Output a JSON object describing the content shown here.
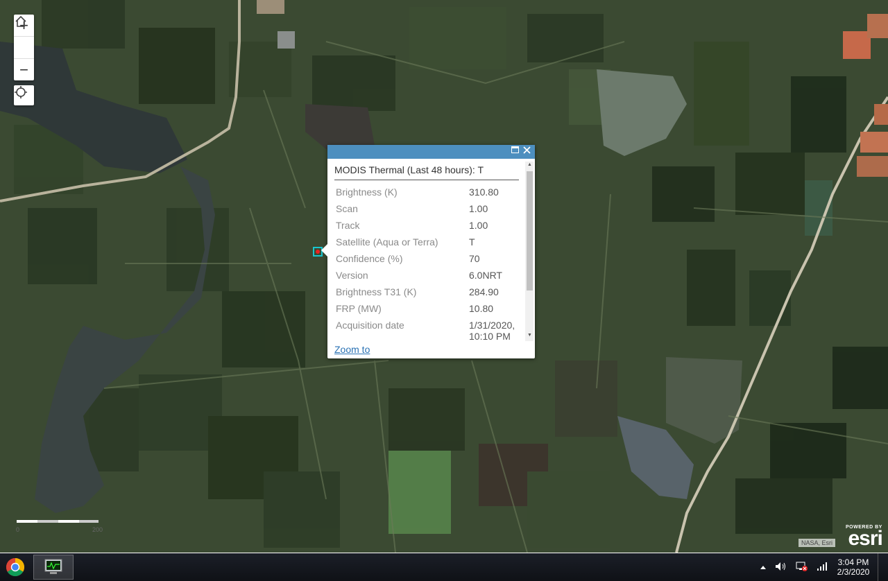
{
  "map": {
    "zoom_in_label": "+",
    "zoom_out_label": "−",
    "home_icon": "home-icon",
    "locate_icon": "crosshair-locate-icon",
    "scale_labels": [
      "0",
      "200"
    ],
    "attribution": "NASA, Esri",
    "powered_by": "POWERED BY",
    "esri_logo": "esri"
  },
  "popup": {
    "title": "MODIS Thermal (Last 48 hours): T",
    "header_color": "#4d8fbf",
    "attributes": [
      {
        "key": "Brightness (K)",
        "value": "310.80"
      },
      {
        "key": "Scan",
        "value": "1.00"
      },
      {
        "key": "Track",
        "value": "1.00"
      },
      {
        "key": "Satellite (Aqua or Terra)",
        "value": "T"
      },
      {
        "key": "Confidence (%)",
        "value": "70"
      },
      {
        "key": "Version",
        "value": "6.0NRT"
      },
      {
        "key": "Brightness T31 (K)",
        "value": "284.90"
      },
      {
        "key": "FRP (MW)",
        "value": "10.80"
      },
      {
        "key": "Acquisition date",
        "value_line1": "1/31/2020,",
        "value_line2": "10:10 PM"
      }
    ],
    "zoom_to": "Zoom to",
    "maximize_icon": "maximize-icon",
    "close_icon": "close-icon"
  },
  "taskbar": {
    "apps": [
      "chrome-icon",
      "system-monitor-icon"
    ],
    "tray_icons": [
      "show-hidden-icons-arrow",
      "volume-icon",
      "network-error-icon",
      "signal-icon"
    ],
    "time": "3:04 PM",
    "date": "2/3/2020"
  }
}
